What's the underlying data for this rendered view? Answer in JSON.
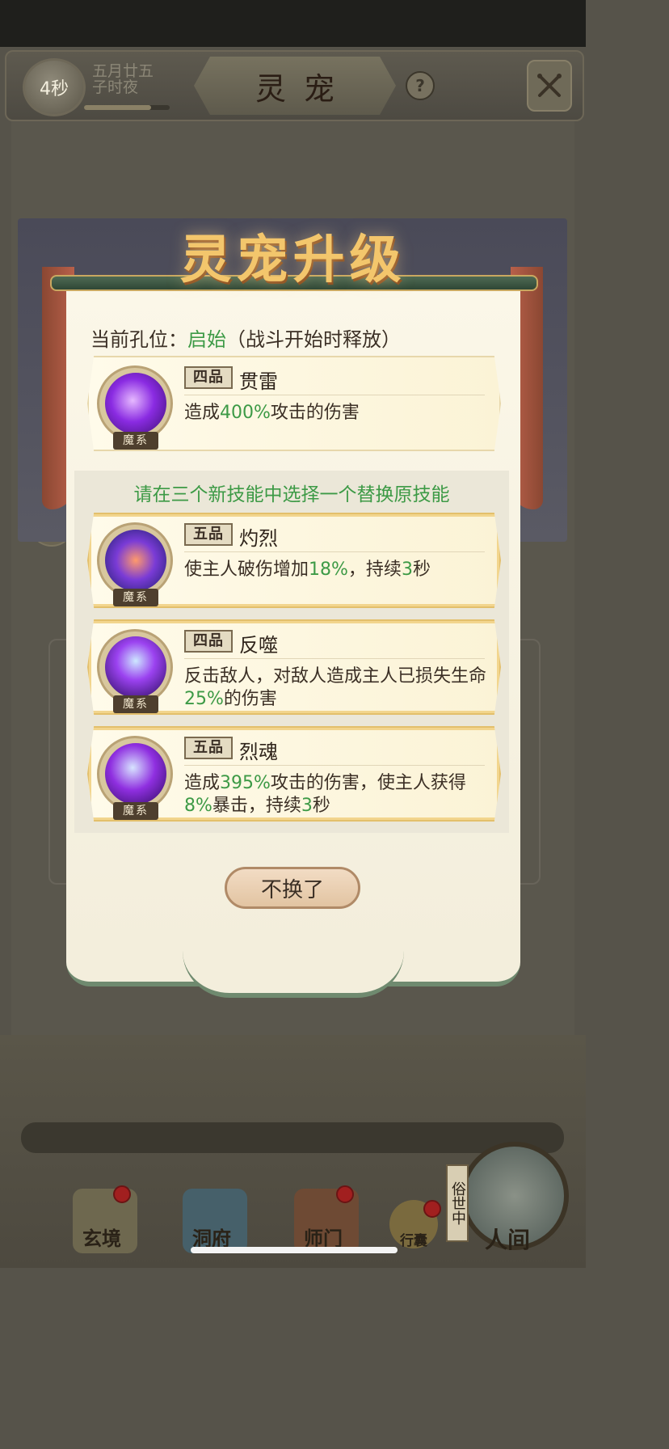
{
  "header": {
    "timer": "4秒",
    "date_line1": "五月廿五",
    "date_line2": "子时夜",
    "day_progress": 0.78,
    "title": "灵宠",
    "help_label": "?"
  },
  "modal": {
    "title": "灵宠升级",
    "current_slot_label": "当前孔位：",
    "current_slot_value": "启始",
    "current_slot_note": "（战斗开始时释放）",
    "current_skill": {
      "tag": "魔系",
      "grade": "四品",
      "name": "贯雷",
      "desc_a": "造成",
      "desc_v1": "400%",
      "desc_b": "攻击的伤害"
    },
    "choose_prompt": "请在三个新技能中选择一个替换原技能",
    "options": [
      {
        "tag": "魔系",
        "grade": "五品",
        "name": "灼烈",
        "desc_a": "使主人破伤增加",
        "desc_v1": "18%",
        "desc_b": "，持续",
        "desc_v2": "3",
        "desc_c": "秒"
      },
      {
        "tag": "魔系",
        "grade": "四品",
        "name": "反噬",
        "desc_a": "反击敌人，对敌人造成主人已损失生命",
        "desc_v1": "25%",
        "desc_b": "的伤害"
      },
      {
        "tag": "魔系",
        "grade": "五品",
        "name": "烈魂",
        "desc_a": "造成",
        "desc_v1": "395%",
        "desc_b": "攻击的伤害，使主人获得",
        "desc_v2": "8%",
        "desc_c": "暴击，持续",
        "desc_v3": "3",
        "desc_d": "秒"
      }
    ],
    "cancel_label": "不换了"
  },
  "nav": {
    "items": [
      "玄境",
      "洞府",
      "师门",
      "行囊",
      "人间"
    ],
    "world_tag": "俗世中"
  },
  "colors": {
    "highlight_green": "#3d9a46",
    "title_gold": "#f3c66c",
    "badge_red": "#a11f1f"
  }
}
